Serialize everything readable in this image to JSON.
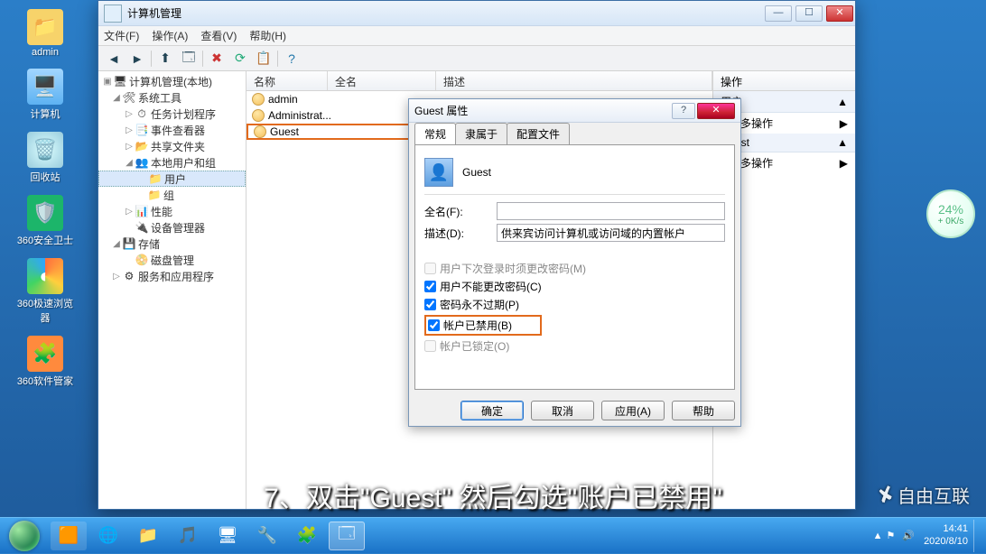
{
  "desktop_icons": {
    "admin": "admin",
    "computer": "计算机",
    "recycle": "回收站",
    "guard360": "360安全卫士",
    "browser360": "360极速浏览器",
    "mgr360": "360软件管家"
  },
  "mmc": {
    "title": "计算机管理",
    "menu": {
      "file": "文件(F)",
      "action": "操作(A)",
      "view": "查看(V)",
      "help": "帮助(H)"
    },
    "tree": {
      "root": "计算机管理(本地)",
      "systools": "系统工具",
      "scheduler": "任务计划程序",
      "eventviewer": "事件查看器",
      "shared": "共享文件夹",
      "localusers": "本地用户和组",
      "users": "用户",
      "groups": "组",
      "perf": "性能",
      "devmgr": "设备管理器",
      "storage": "存储",
      "diskmgr": "磁盘管理",
      "services": "服务和应用程序"
    },
    "list": {
      "head_name": "名称",
      "head_full": "全名",
      "head_desc": "描述",
      "rows": [
        "admin",
        "Administrat...",
        "Guest"
      ]
    },
    "actions": {
      "title": "操作",
      "sec1": "用户",
      "more": "更多操作",
      "sec2": "Guest"
    }
  },
  "dialog": {
    "title": "Guest 属性",
    "tabs": {
      "general": "常规",
      "member": "隶属于",
      "profile": "配置文件"
    },
    "icon_label": "Guest",
    "full_name_label": "全名(F):",
    "full_name_value": "",
    "desc_label": "描述(D):",
    "desc_value": "供来宾访问计算机或访问域的内置帐户",
    "cb_change_pw": "用户下次登录时须更改密码(M)",
    "cb_cannot_change": "用户不能更改密码(C)",
    "cb_never_expire": "密码永不过期(P)",
    "cb_disabled": "帐户已禁用(B)",
    "cb_locked": "帐户已锁定(O)",
    "btn_ok": "确定",
    "btn_cancel": "取消",
    "btn_apply": "应用(A)",
    "btn_help": "帮助"
  },
  "speed": {
    "pct": "24%",
    "rate": "+ 0K/s"
  },
  "caption": "7、双击\"Guest\" 然后勾选\"账户已禁用\"",
  "watermark": "自由互联",
  "taskbar": {
    "time": "14:41",
    "date": "2020/8/10"
  }
}
